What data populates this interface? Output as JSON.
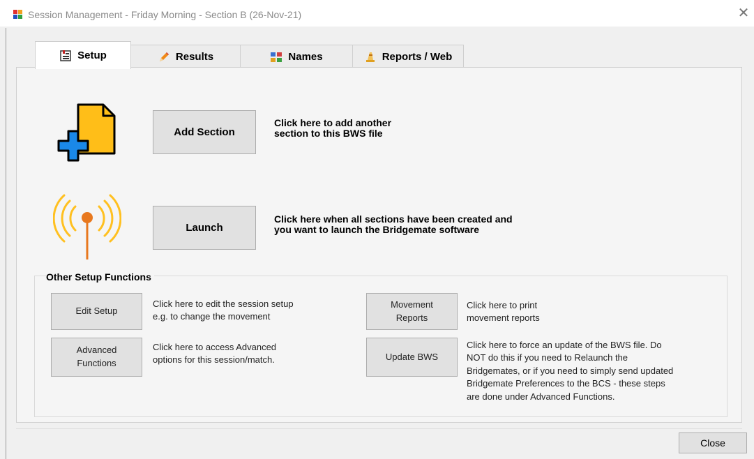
{
  "window": {
    "title": "Session Management - Friday Morning - Section B (26-Nov-21)",
    "close_glyph": "✕"
  },
  "tabs": [
    {
      "label": "Setup",
      "icon": "setup-icon",
      "active": true
    },
    {
      "label": "Results",
      "icon": "pencil-icon",
      "active": false
    },
    {
      "label": "Names",
      "icon": "names-icon",
      "active": false
    },
    {
      "label": "Reports / Web",
      "icon": "reports-web-icon",
      "active": false
    }
  ],
  "setup": {
    "add_section": {
      "button": "Add Section",
      "description_line1": "Click here to add another",
      "description_line2": "section to this BWS file",
      "icon": "add-document-icon"
    },
    "launch": {
      "button": "Launch",
      "description_line1": "Click here when all sections have been created and",
      "description_line2": "you want to launch the Bridgemate software",
      "icon": "antenna-icon"
    },
    "other": {
      "title": "Other Setup Functions",
      "edit_setup": {
        "button": "Edit Setup",
        "description_line1": "Click here to edit the session setup",
        "description_line2": "e.g. to change the movement"
      },
      "advanced": {
        "button_line1": "Advanced",
        "button_line2": "Functions",
        "description_line1": "Click here to access Advanced",
        "description_line2": "options for this session/match."
      },
      "movement_reports": {
        "button_line1": "Movement",
        "button_line2": "Reports",
        "description_line1": "Click here to print",
        "description_line2": "movement reports"
      },
      "update_bws": {
        "button": "Update BWS",
        "description_lines": [
          "Click here to force an update of the BWS file. Do",
          "NOT do this if you need to Relaunch the",
          "Bridgemates, or if you need to simply send updated",
          "Bridgemate Preferences to the BCS - these steps",
          "are done under Advanced Functions."
        ]
      }
    }
  },
  "footer": {
    "close_button": "Close"
  },
  "colors": {
    "doc_yellow": "#ffbe18",
    "plus_blue": "#1a88e8",
    "antenna_orange": "#e8781e",
    "wave_yellow": "#ffc020"
  }
}
